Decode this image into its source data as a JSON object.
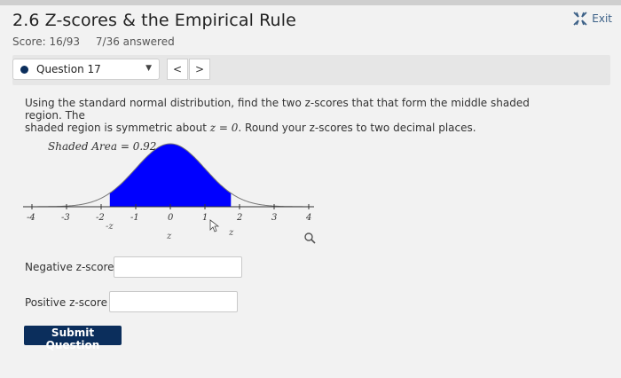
{
  "header": {
    "title": "2.6 Z-scores & the Empirical Rule",
    "score_label": "Score: 16/93",
    "answered": "7/36 answered",
    "exit_label": "Exit"
  },
  "question_nav": {
    "current": "Question 17",
    "prev": "<",
    "next": ">"
  },
  "prompt": {
    "line1": "Using the standard normal distribution, find the two z-scores that that form the middle shaded region. The",
    "line2_pre": "shaded region is symmetric about ",
    "line2_math": "z = 0",
    "line2_post": ". Round your z-scores to two decimal places."
  },
  "chart_data": {
    "type": "area",
    "annotation": "Shaded Area = 0.92",
    "x_ticks": [
      "-4",
      "-3",
      "-2",
      "-1",
      "0",
      "1",
      "2",
      "3",
      "4"
    ],
    "xlim": [
      -4,
      4
    ],
    "shaded_range": [
      -1.75,
      1.75
    ],
    "shaded_area": 0.92,
    "marker_labels": [
      "-z",
      "z",
      "z"
    ],
    "fill_color": "#0000ff"
  },
  "form": {
    "negative_label": "Negative z-score =",
    "negative_value": "",
    "positive_label": "Positive z-score =",
    "positive_value": "",
    "submit_label": "Submit Question"
  },
  "colors": {
    "accent": "#0b2e5c",
    "background": "#f2f2f2"
  }
}
